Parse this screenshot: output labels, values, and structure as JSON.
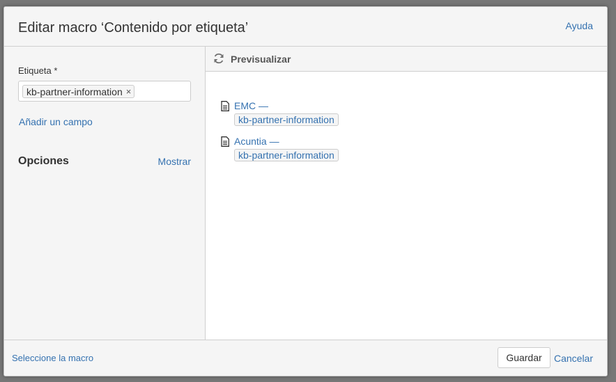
{
  "dialog": {
    "title": "Editar macro ‘Contenido por etiqueta’",
    "help_label": "Ayuda"
  },
  "left_panel": {
    "field_label": "Etiqueta *",
    "selected_tag": "kb-partner-information",
    "remove_glyph": "×",
    "add_field_label": "Añadir un campo",
    "options_title": "Opciones",
    "show_label": "Mostrar"
  },
  "preview": {
    "label": "Previsualizar",
    "refresh_icon": "refresh-icon",
    "results": [
      {
        "title": "EMC —",
        "tag": "kb-partner-information",
        "icon": "page-icon"
      },
      {
        "title": "Acuntia —",
        "tag": "kb-partner-information",
        "icon": "page-icon"
      }
    ]
  },
  "footer": {
    "select_macro_label": "Seleccione la macro",
    "save_label": "Guardar",
    "cancel_label": "Cancelar"
  },
  "colors": {
    "link": "#3572b0",
    "panel_bg": "#f5f5f5",
    "border": "#cfcfcf"
  }
}
